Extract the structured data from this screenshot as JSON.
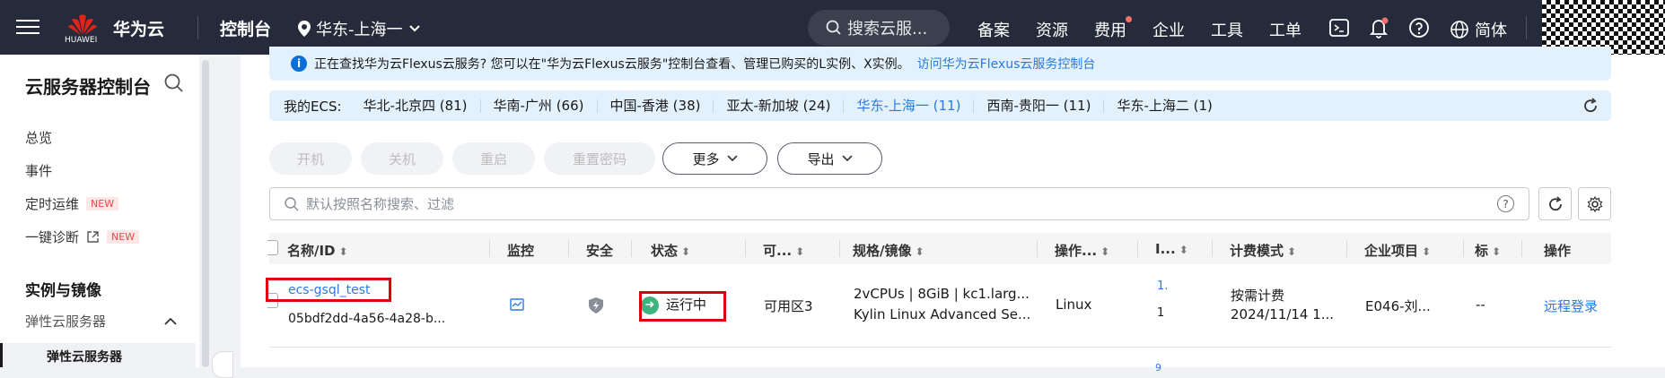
{
  "topbar": {
    "logo_text": "HUAWEI",
    "brand": "华为云",
    "console": "控制台",
    "region": "华东-上海一",
    "search_placeholder": "搜索云服...",
    "nav": [
      "备案",
      "资源",
      "费用",
      "企业",
      "工具",
      "工单"
    ],
    "lang": "简体"
  },
  "sidebar": {
    "title": "云服务器控制台",
    "items": [
      {
        "label": "总览"
      },
      {
        "label": "事件"
      },
      {
        "label": "定时运维",
        "badge": "NEW"
      },
      {
        "label": "一键诊断",
        "badge": "NEW"
      }
    ],
    "section": "实例与镜像",
    "sub_group": "弹性云服务器",
    "active_item": "弹性云服务器"
  },
  "notice": {
    "text": "正在查找华为云Flexus云服务? 您可以在\"华为云Flexus云服务\"控制台查看、管理已购买的L实例、X实例。",
    "link": "访问华为云Flexus云服务控制台"
  },
  "ecs_regions": {
    "label": "我的ECS:",
    "items": [
      "华北-北京四 (81)",
      "华南-广州 (66)",
      "中国-香港 (38)",
      "亚太-新加坡 (24)",
      "华东-上海一 (11)",
      "西南-贵阳一 (11)",
      "华东-上海二 (1)"
    ],
    "selected": "华东-上海一 (11)"
  },
  "toolbar": {
    "start": "开机",
    "stop": "关机",
    "restart": "重启",
    "reset_pwd": "重置密码",
    "more": "更多",
    "export": "导出"
  },
  "filter": {
    "placeholder": "默认按照名称搜索、过滤"
  },
  "table": {
    "headers": [
      "名称/ID",
      "监控",
      "安全",
      "状态",
      "可...",
      "规格/镜像",
      "操作...",
      "I...",
      "计费模式",
      "企业项目",
      "标",
      "操作"
    ],
    "row": {
      "name": "ecs-gsql_test",
      "id": "05bdf2dd-4a56-4a28-b...",
      "status": "运行中",
      "az": "可用区3",
      "spec": "2vCPUs | 8GiB | kc1.larg...",
      "image": "Kylin Linux Advanced Se...",
      "os": "Linux",
      "ip1": "1.",
      "ip2": "1",
      "billing": "按需计费",
      "billing_time": "2024/11/14 1...",
      "project": "E046-刘...",
      "tag": "--",
      "action": "远程登录"
    },
    "next_row_partial": "9"
  },
  "colors": {
    "topbar": "#252b3a",
    "accent": "#2a7ae2",
    "highlight": "#e0000a",
    "running": "#3db37d"
  }
}
